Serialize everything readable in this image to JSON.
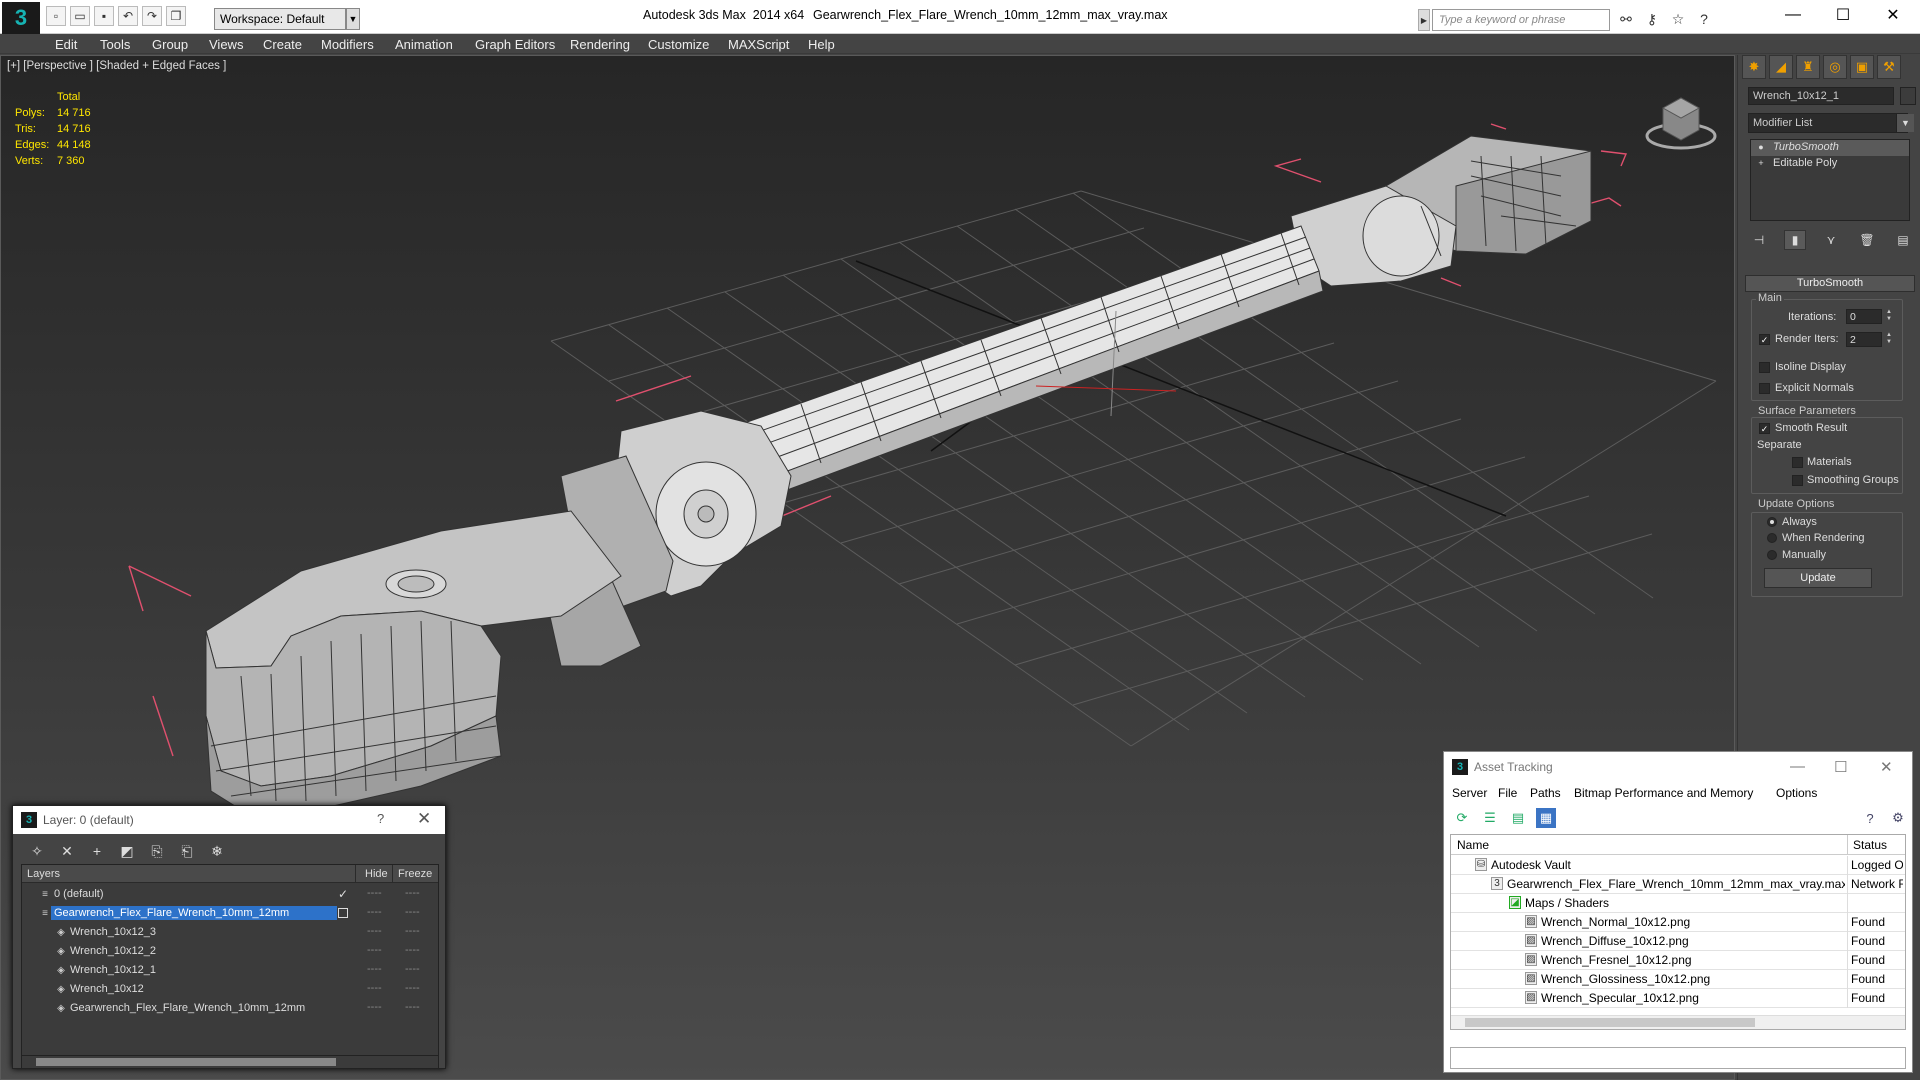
{
  "titlebar": {
    "app_title": "Autodesk 3ds Max  2014 x64",
    "file_title": "Gearwrench_Flex_Flare_Wrench_10mm_12mm_max_vray.max",
    "workspace": "Workspace: Default",
    "search_placeholder": "Type a keyword or phrase",
    "quick_access_icons": [
      "new-icon",
      "open-icon",
      "save-icon",
      "undo-icon",
      "redo-icon",
      "project-icon"
    ],
    "toolbar_icons": [
      "binoculars-icon",
      "key-icon",
      "star-icon",
      "help-icon"
    ]
  },
  "menu": [
    "Edit",
    "Tools",
    "Group",
    "Views",
    "Create",
    "Modifiers",
    "Animation",
    "Graph Editors",
    "Rendering",
    "Customize",
    "MAXScript",
    "Help"
  ],
  "viewport": {
    "label": "[+] [Perspective ] [Shaded + Edged Faces ]",
    "stats": {
      "header": "Total",
      "rows": [
        {
          "k": "Polys:",
          "v": "14 716"
        },
        {
          "k": "Tris:",
          "v": "14 716"
        },
        {
          "k": "Edges:",
          "v": "44 148"
        },
        {
          "k": "Verts:",
          "v": "7 360"
        }
      ]
    },
    "colors": {
      "stats": "#ffe600",
      "selection_bbox": "#e0506e",
      "wire": "#333333",
      "mesh": "#d6d6d6"
    }
  },
  "command_panel": {
    "tabs": [
      "create-icon",
      "modify-icon",
      "hierarchy-icon",
      "motion-icon",
      "display-icon",
      "utilities-icon"
    ],
    "object_name": "Wrench_10x12_1",
    "modifier_list": "Modifier List",
    "stack": [
      "TurboSmooth",
      "Editable Poly"
    ],
    "rollout": "TurboSmooth",
    "main": {
      "group": "Main",
      "iterations_label": "Iterations:",
      "iterations": "0",
      "render_iters_label": "Render Iters:",
      "render_iters": "2",
      "render_iters_checked": true,
      "isoline": "Isoline Display",
      "explicit": "Explicit Normals"
    },
    "surface": {
      "group": "Surface Parameters",
      "smooth": "Smooth Result",
      "smooth_checked": true,
      "separate": "Separate",
      "materials": "Materials",
      "smoothing_groups": "Smoothing Groups"
    },
    "update": {
      "group": "Update Options",
      "always": "Always",
      "when_rendering": "When Rendering",
      "manually": "Manually",
      "button": "Update",
      "selected": "Always"
    }
  },
  "layer_dialog": {
    "title": "Layer: 0 (default)",
    "help": "?",
    "columns": {
      "layers": "Layers",
      "hide": "Hide",
      "freeze": "Freeze"
    },
    "rows": [
      {
        "name": "0 (default)",
        "indent": 0,
        "current": true,
        "selected": false
      },
      {
        "name": "Gearwrench_Flex_Flare_Wrench_10mm_12mm",
        "indent": 0,
        "current": false,
        "selected": true
      },
      {
        "name": "Wrench_10x12_3",
        "indent": 1,
        "selected": false
      },
      {
        "name": "Wrench_10x12_2",
        "indent": 1,
        "selected": false
      },
      {
        "name": "Wrench_10x12_1",
        "indent": 1,
        "selected": false
      },
      {
        "name": "Wrench_10x12",
        "indent": 1,
        "selected": false
      },
      {
        "name": "Gearwrench_Flex_Flare_Wrench_10mm_12mm",
        "indent": 1,
        "selected": false
      }
    ],
    "dash": "----"
  },
  "asset_dialog": {
    "title": "Asset Tracking",
    "menu": [
      "Server",
      "File",
      "Paths",
      "Bitmap Performance and Memory",
      "Options"
    ],
    "columns": {
      "name": "Name",
      "status": "Status"
    },
    "rows": [
      {
        "name": "Autodesk Vault",
        "status": "Logged O",
        "indent": 1
      },
      {
        "name": "Gearwrench_Flex_Flare_Wrench_10mm_12mm_max_vray.max",
        "status": "Network F",
        "indent": 2
      },
      {
        "name": "Maps / Shaders",
        "status": "",
        "indent": 3
      },
      {
        "name": "Wrench_Normal_10x12.png",
        "status": "Found",
        "indent": 4
      },
      {
        "name": "Wrench_Diffuse_10x12.png",
        "status": "Found",
        "indent": 4
      },
      {
        "name": "Wrench_Fresnel_10x12.png",
        "status": "Found",
        "indent": 4
      },
      {
        "name": "Wrench_Glossiness_10x12.png",
        "status": "Found",
        "indent": 4
      },
      {
        "name": "Wrench_Specular_10x12.png",
        "status": "Found",
        "indent": 4
      }
    ]
  }
}
